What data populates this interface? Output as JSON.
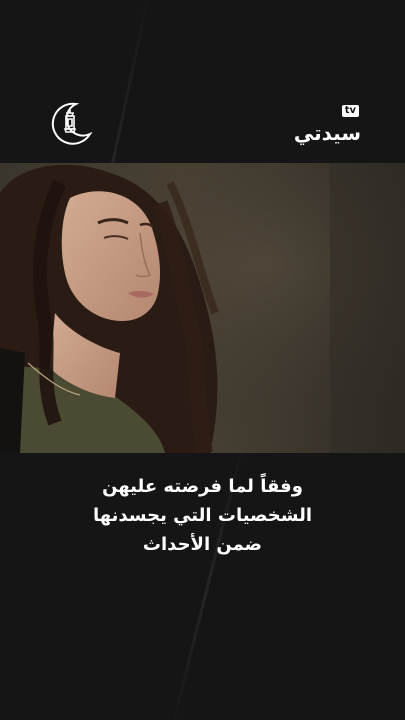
{
  "header": {
    "moon_logo_icon": "crescent-moon-lantern-icon",
    "brand": {
      "name": "سيدتي",
      "badge": "tv"
    }
  },
  "video": {
    "subject": "video-still"
  },
  "caption": {
    "lines": [
      "وفقاً لما فرضته عليهن",
      "الشخصيات التي يجسدنها",
      "ضمن الأحداث"
    ]
  },
  "colors": {
    "background": "#151515",
    "text": "#ffffff",
    "hair": "#2a1b14",
    "skin": "#c99f86",
    "shirt": "#4b4a33"
  }
}
